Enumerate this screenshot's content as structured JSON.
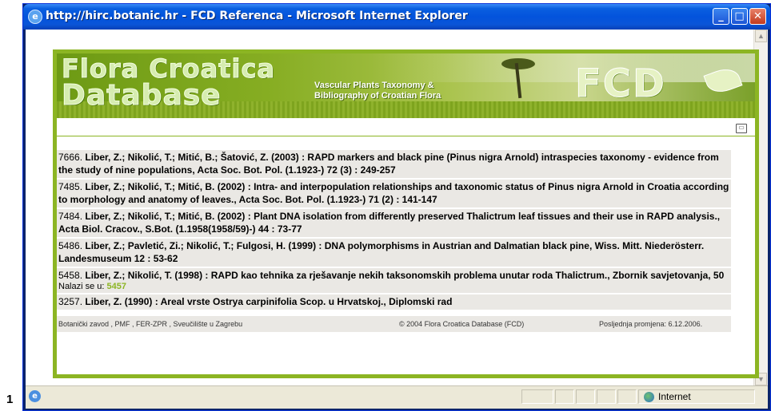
{
  "stray_char": "1",
  "window": {
    "title": "http://hirc.botanic.hr - FCD Referenca - Microsoft Internet Explorer",
    "buttons": {
      "minimize": "_",
      "maximize": "□",
      "close": "✕"
    }
  },
  "header": {
    "logo_line1": "Flora Croatica",
    "logo_line2": "Database",
    "subtitle_line1": "Vascular Plants Taxonomy &",
    "subtitle_line2": "Bibliography of Croatian Flora",
    "brand": "FCD"
  },
  "entries": [
    {
      "num": "7666.",
      "ref": "Liber, Z.; Nikolić, T.; Mitić, B.; Šatović, Z. (2003) : RAPD markers and black pine (Pinus nigra Arnold) intraspecies taxonomy - evidence from the study of nine populations, Acta Soc. Bot. Pol. (1.1923-) 72 (3) : 249-257"
    },
    {
      "num": "7485.",
      "ref": "Liber, Z.; Nikolić, T.; Mitić, B. (2002) : Intra- and interpopulation relationships and taxonomic status of Pinus nigra Arnold in Croatia according to morphology and anatomy of leaves., Acta Soc. Bot. Pol. (1.1923-) 71 (2) : 141-147"
    },
    {
      "num": "7484.",
      "ref": "Liber, Z.; Nikolić, T.; Mitić, B. (2002) : Plant DNA isolation from differently preserved Thalictrum leaf tissues and their use in RAPD analysis., Acta Biol. Cracov., S.Bot. (1.1958(1958/59)-) 44 : 73-77"
    },
    {
      "num": "5486.",
      "ref": "Liber, Z.; Pavletić, Zi.; Nikolić, T.; Fulgosi, H. (1999) : DNA polymorphisms in Austrian and Dalmatian black pine, Wiss. Mitt. Niederösterr. Landesmuseum 12 : 53-62"
    },
    {
      "num": "5458.",
      "ref": "Liber, Z.; Nikolić, T. (1998) : RAPD kao tehnika za rješavanje nekih taksonomskih problema unutar roda Thalictrum., Zbornik savjetovanja, 50"
    },
    {
      "num": "3257.",
      "ref": "Liber, Z. (1990) : Areal vrste Ostrya carpinifolia Scop. u Hrvatskoj., Diplomski rad"
    }
  ],
  "located": {
    "label": "Nalazi se u:",
    "value": "5457"
  },
  "footer": {
    "left": "Botanički zavod , PMF , FER-ZPR , Sveučilište u Zagrebu",
    "center": "© 2004 Flora Croatica Database (FCD)",
    "right": "Posljednja promjena: 6.12.2006."
  },
  "statusbar": {
    "zone": "Internet"
  },
  "colors": {
    "accent": "#8cb523",
    "titlebar": "#0353dc",
    "entry_bg": "#eae8e4"
  }
}
